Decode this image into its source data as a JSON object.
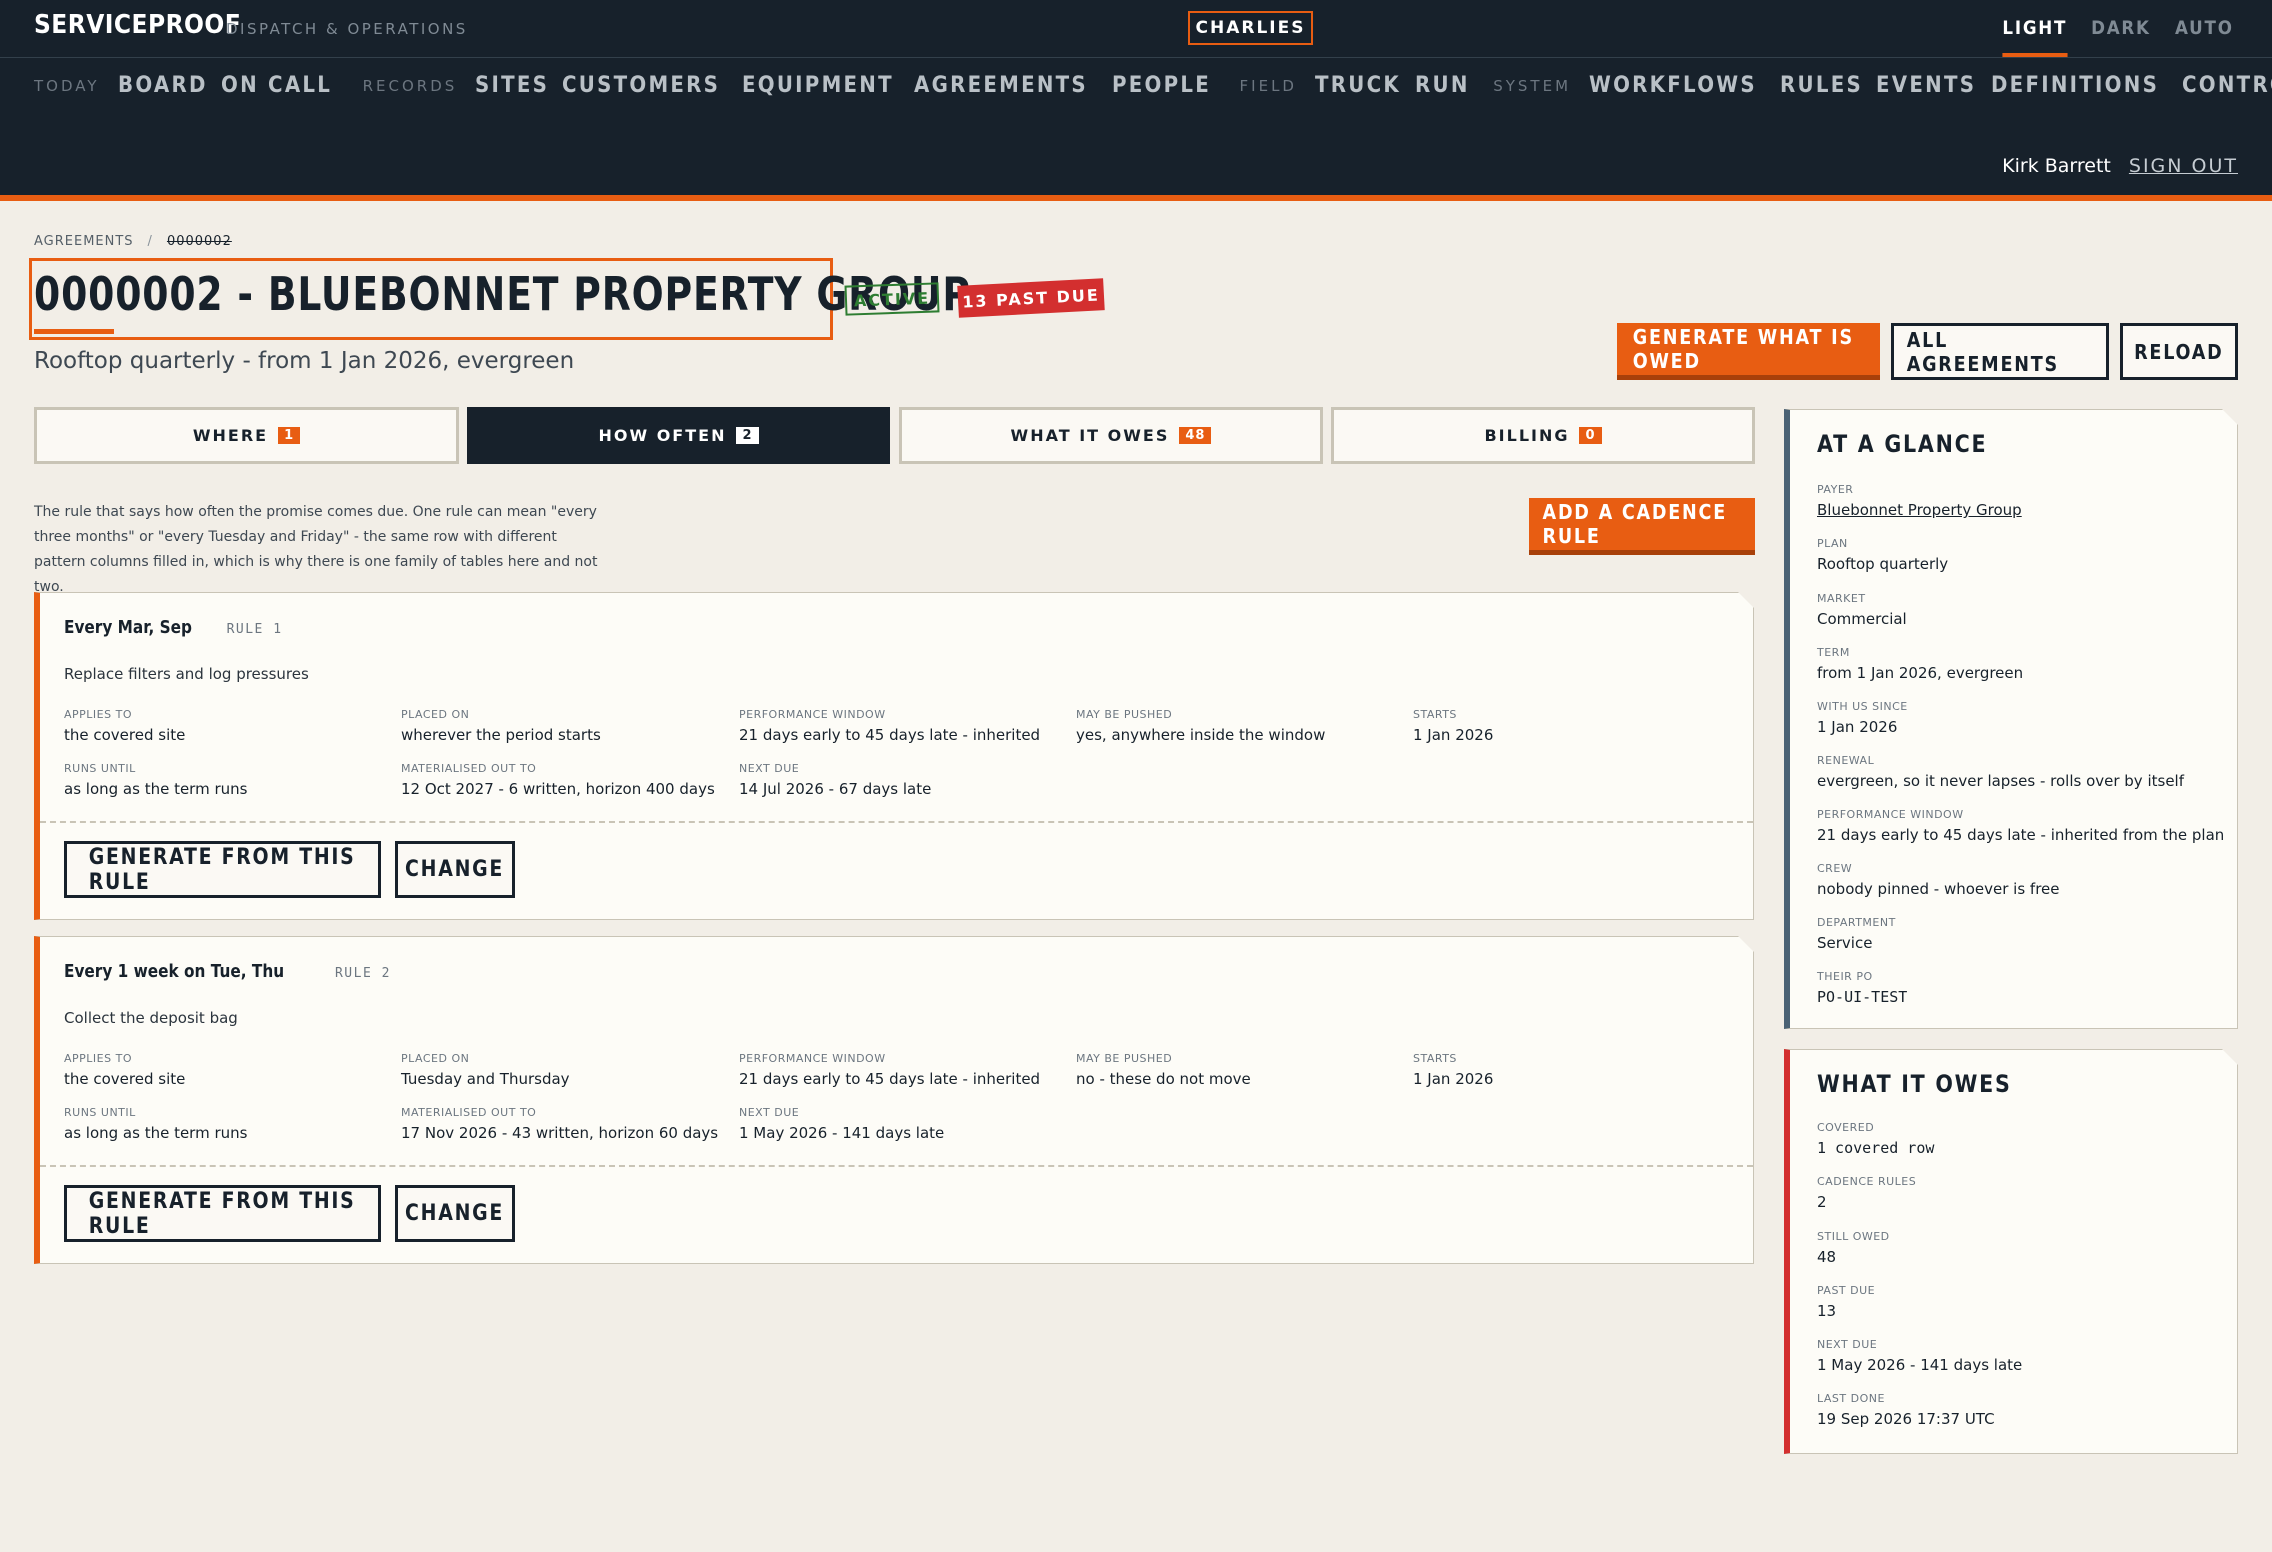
{
  "app": {
    "brand": "SERVICEPROOF",
    "brand_sub": "DISPATCH & OPERATIONS",
    "tenant": "CHARLIES",
    "theme": [
      "LIGHT",
      "DARK",
      "AUTO"
    ],
    "user_name": "Kirk Barrett",
    "sign_out": "SIGN OUT"
  },
  "nav": {
    "today_label": "TODAY",
    "today": [
      "BOARD",
      "ON CALL"
    ],
    "records_label": "RECORDS",
    "records": [
      "SITES",
      "CUSTOMERS",
      "EQUIPMENT",
      "AGREEMENTS",
      "PEOPLE"
    ],
    "field_label": "FIELD",
    "field": [
      "TRUCK",
      "RUN"
    ],
    "system_label": "SYSTEM",
    "system": [
      "WORKFLOWS",
      "RULES",
      "EVENTS",
      "DEFINITIONS",
      "CONTROL KIT"
    ]
  },
  "breadcrumb": {
    "parent": "AGREEMENTS",
    "sep": "/",
    "current": "0000002"
  },
  "header": {
    "title": "0000002 - BLUEBONNET PROPERTY GROUP",
    "status": "ACTIVE",
    "past_due": "13 PAST DUE",
    "subtitle": "Rooftop quarterly - from 1 Jan 2026, evergreen"
  },
  "actions": {
    "generate": "GENERATE WHAT IS OWED",
    "all": "ALL AGREEMENTS",
    "reload": "RELOAD"
  },
  "tabs": [
    {
      "label": "WHERE",
      "count": "1"
    },
    {
      "label": "HOW OFTEN",
      "count": "2"
    },
    {
      "label": "WHAT IT OWES",
      "count": "48"
    },
    {
      "label": "BILLING",
      "count": "0"
    }
  ],
  "intro": "The rule that says how often the promise comes due. One rule can mean \"every three months\" or \"every Tuesday and Friday\" - the same row with different pattern columns filled in, which is why there is one family of tables here and not two.",
  "add_rule": "ADD A CADENCE RULE",
  "rules": [
    {
      "title": "Every Mar, Sep",
      "rule": "RULE 1",
      "desc": "Replace filters and log pressures",
      "fields": [
        {
          "label": "APPLIES TO",
          "value": "the covered site"
        },
        {
          "label": "PLACED ON",
          "value": "wherever the period starts"
        },
        {
          "label": "PERFORMANCE WINDOW",
          "value": "21 days early to 45 days late - inherited"
        },
        {
          "label": "MAY BE PUSHED",
          "value": "yes, anywhere inside the window"
        },
        {
          "label": "STARTS",
          "value": "1 Jan 2026"
        },
        {
          "label": "RUNS UNTIL",
          "value": "as long as the term runs"
        },
        {
          "label": "MATERIALISED OUT TO",
          "value": "12 Oct 2027 - 6 written, horizon 400 days"
        },
        {
          "label": "NEXT DUE",
          "value": "14 Jul 2026 - 67 days late"
        }
      ],
      "generate": "GENERATE FROM THIS RULE",
      "change": "CHANGE"
    },
    {
      "title": "Every 1 week on Tue, Thu",
      "rule": "RULE 2",
      "desc": "Collect the deposit bag",
      "fields": [
        {
          "label": "APPLIES TO",
          "value": "the covered site"
        },
        {
          "label": "PLACED ON",
          "value": "Tuesday and Thursday"
        },
        {
          "label": "PERFORMANCE WINDOW",
          "value": "21 days early to 45 days late - inherited"
        },
        {
          "label": "MAY BE PUSHED",
          "value": "no - these do not move"
        },
        {
          "label": "STARTS",
          "value": "1 Jan 2026"
        },
        {
          "label": "RUNS UNTIL",
          "value": "as long as the term runs"
        },
        {
          "label": "MATERIALISED OUT TO",
          "value": "17 Nov 2026 - 43 written, horizon 60 days"
        },
        {
          "label": "NEXT DUE",
          "value": "1 May 2026 - 141 days late"
        }
      ],
      "generate": "GENERATE FROM THIS RULE",
      "change": "CHANGE"
    }
  ],
  "glance": {
    "title": "AT A GLANCE",
    "fields": [
      {
        "label": "PAYER",
        "value": "Bluebonnet Property Group"
      },
      {
        "label": "PLAN",
        "value": "Rooftop quarterly"
      },
      {
        "label": "MARKET",
        "value": "Commercial"
      },
      {
        "label": "TERM",
        "value": "from 1 Jan 2026, evergreen"
      },
      {
        "label": "WITH US SINCE",
        "value": "1 Jan 2026"
      },
      {
        "label": "RENEWAL",
        "value": "evergreen, so it never lapses - rolls over by itself"
      },
      {
        "label": "PERFORMANCE WINDOW",
        "value": "21 days early to 45 days late - inherited from the plan"
      },
      {
        "label": "CREW",
        "value": "nobody pinned - whoever is free"
      },
      {
        "label": "DEPARTMENT",
        "value": "Service"
      },
      {
        "label": "THEIR PO",
        "value": "PO-UI-TEST"
      }
    ]
  },
  "owes": {
    "title": "WHAT IT OWES",
    "fields": [
      {
        "label": "COVERED",
        "value": "1 covered row"
      },
      {
        "label": "CADENCE RULES",
        "value": "2"
      },
      {
        "label": "STILL OWED",
        "value": "48"
      },
      {
        "label": "PAST DUE",
        "value": "13"
      },
      {
        "label": "NEXT DUE",
        "value": "1 May 2026 - 141 days late"
      },
      {
        "label": "LAST DONE",
        "value": "19 Sep 2026 17:37 UTC"
      }
    ]
  },
  "colors": {
    "accent": "#e85d12",
    "navy": "#17212b",
    "good": "#2e7d32",
    "bad": "#d32f2f",
    "glance_rail": "#4b6275",
    "owes_rail": "#d32f2f"
  }
}
